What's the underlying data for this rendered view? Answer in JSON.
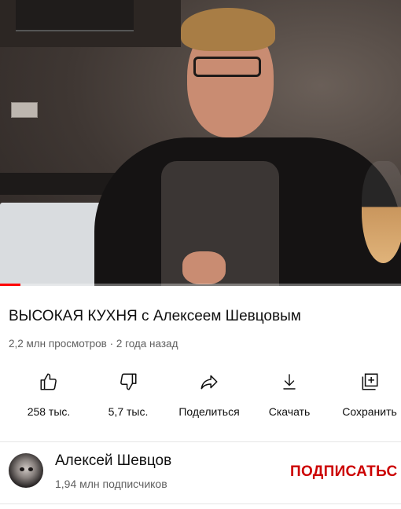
{
  "video": {
    "title": "ВЫСОКАЯ КУХНЯ с Алексеем Шевцовым",
    "meta": "2,2 млн просмотров · 2 года назад",
    "progress_fraction": 0.05,
    "progress_color": "#ff0000"
  },
  "actions": [
    {
      "icon": "thumbs-up-icon",
      "label": "258 тыс."
    },
    {
      "icon": "thumbs-down-icon",
      "label": "5,7 тыс."
    },
    {
      "icon": "share-icon",
      "label": "Поделиться"
    },
    {
      "icon": "download-icon",
      "label": "Скачать"
    },
    {
      "icon": "save-to-playlist-icon",
      "label": "Сохранить"
    }
  ],
  "channel": {
    "name": "Алексей Шевцов",
    "subscribers": "1,94 млн подписчиков",
    "subscribe_label": "ПОДПИСАТЬС",
    "subscribe_color": "#cc0000"
  }
}
